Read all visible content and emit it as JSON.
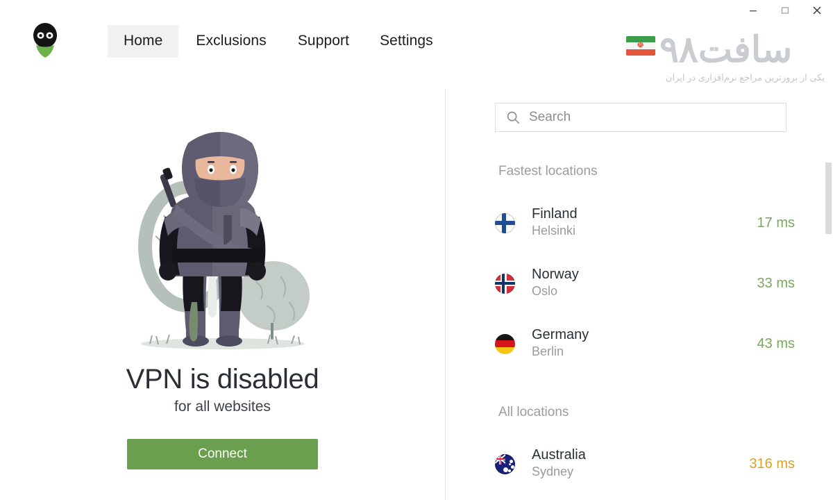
{
  "window": {
    "controls": [
      {
        "name": "minimize",
        "glyph": "minimize-icon"
      },
      {
        "name": "maximize",
        "glyph": "maximize-icon"
      },
      {
        "name": "close",
        "glyph": "close-icon"
      }
    ]
  },
  "nav": {
    "logo_name": "ninja-logo",
    "tabs": [
      {
        "label": "Home",
        "active": true
      },
      {
        "label": "Exclusions",
        "active": false
      },
      {
        "label": "Support",
        "active": false
      },
      {
        "label": "Settings",
        "active": false
      }
    ]
  },
  "watermark": {
    "title": "سافت۹۸",
    "tagline": "یکی از بروزترین مراجع نرم‌افزاری در ایران",
    "flag_emblem": "☫",
    "color": "#c9cdd2"
  },
  "main": {
    "illustration_name": "ninja-illustration",
    "status_title": "VPN is disabled",
    "status_subtitle": "for all websites",
    "connect_label": "Connect",
    "connect_color": "#699f4d"
  },
  "search": {
    "placeholder": "Search",
    "value": ""
  },
  "locations": {
    "fastest_heading": "Fastest locations",
    "all_heading": "All locations",
    "fastest": [
      {
        "country": "Finland",
        "city": "Helsinki",
        "ping": "17 ms",
        "ping_state": "good",
        "flag": "fi"
      },
      {
        "country": "Norway",
        "city": "Oslo",
        "ping": "33 ms",
        "ping_state": "good",
        "flag": "no"
      },
      {
        "country": "Germany",
        "city": "Berlin",
        "ping": "43 ms",
        "ping_state": "good",
        "flag": "de"
      }
    ],
    "all": [
      {
        "country": "Australia",
        "city": "Sydney",
        "ping": "316 ms",
        "ping_state": "slow",
        "flag": "au"
      }
    ]
  },
  "colors": {
    "ping_good": "#7aa75f",
    "ping_slow": "#d9a225",
    "accent_green": "#699f4d",
    "tab_active_bg": "#f1f1f1"
  }
}
